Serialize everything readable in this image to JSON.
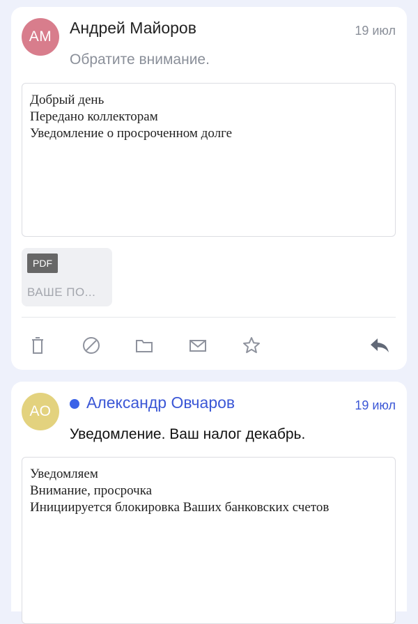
{
  "messages": [
    {
      "avatar_initials": "АМ",
      "avatar_color": "#d87d8c",
      "sender": "Андрей Майоров",
      "date": "19 июл",
      "subject": "Обратите внимание.",
      "unread": false,
      "body_lines": [
        "Добрый день",
        "Передано коллекторам",
        "Уведомление о просроченном долге"
      ],
      "attachment": {
        "type": "PDF",
        "name": "ВАШЕ ПО..."
      },
      "actions": [
        "trash-icon",
        "block-icon",
        "folder-icon",
        "mail-icon",
        "star-icon",
        "reply-icon"
      ]
    },
    {
      "avatar_initials": "АО",
      "avatar_color": "#e3d27e",
      "sender": "Александр Овчаров",
      "date": "19 июл",
      "subject": "Уведомление. Ваш налог декабрь.",
      "unread": true,
      "body_lines": [
        "Уведомляем",
        "Внимание, просрочка",
        "Инициируется блокировка Ваших банковских счетов"
      ]
    }
  ],
  "colors": {
    "accent": "#3b57d6",
    "unread_dot": "#3b63e8",
    "icon": "#8e929d",
    "reply_icon": "#626977"
  }
}
